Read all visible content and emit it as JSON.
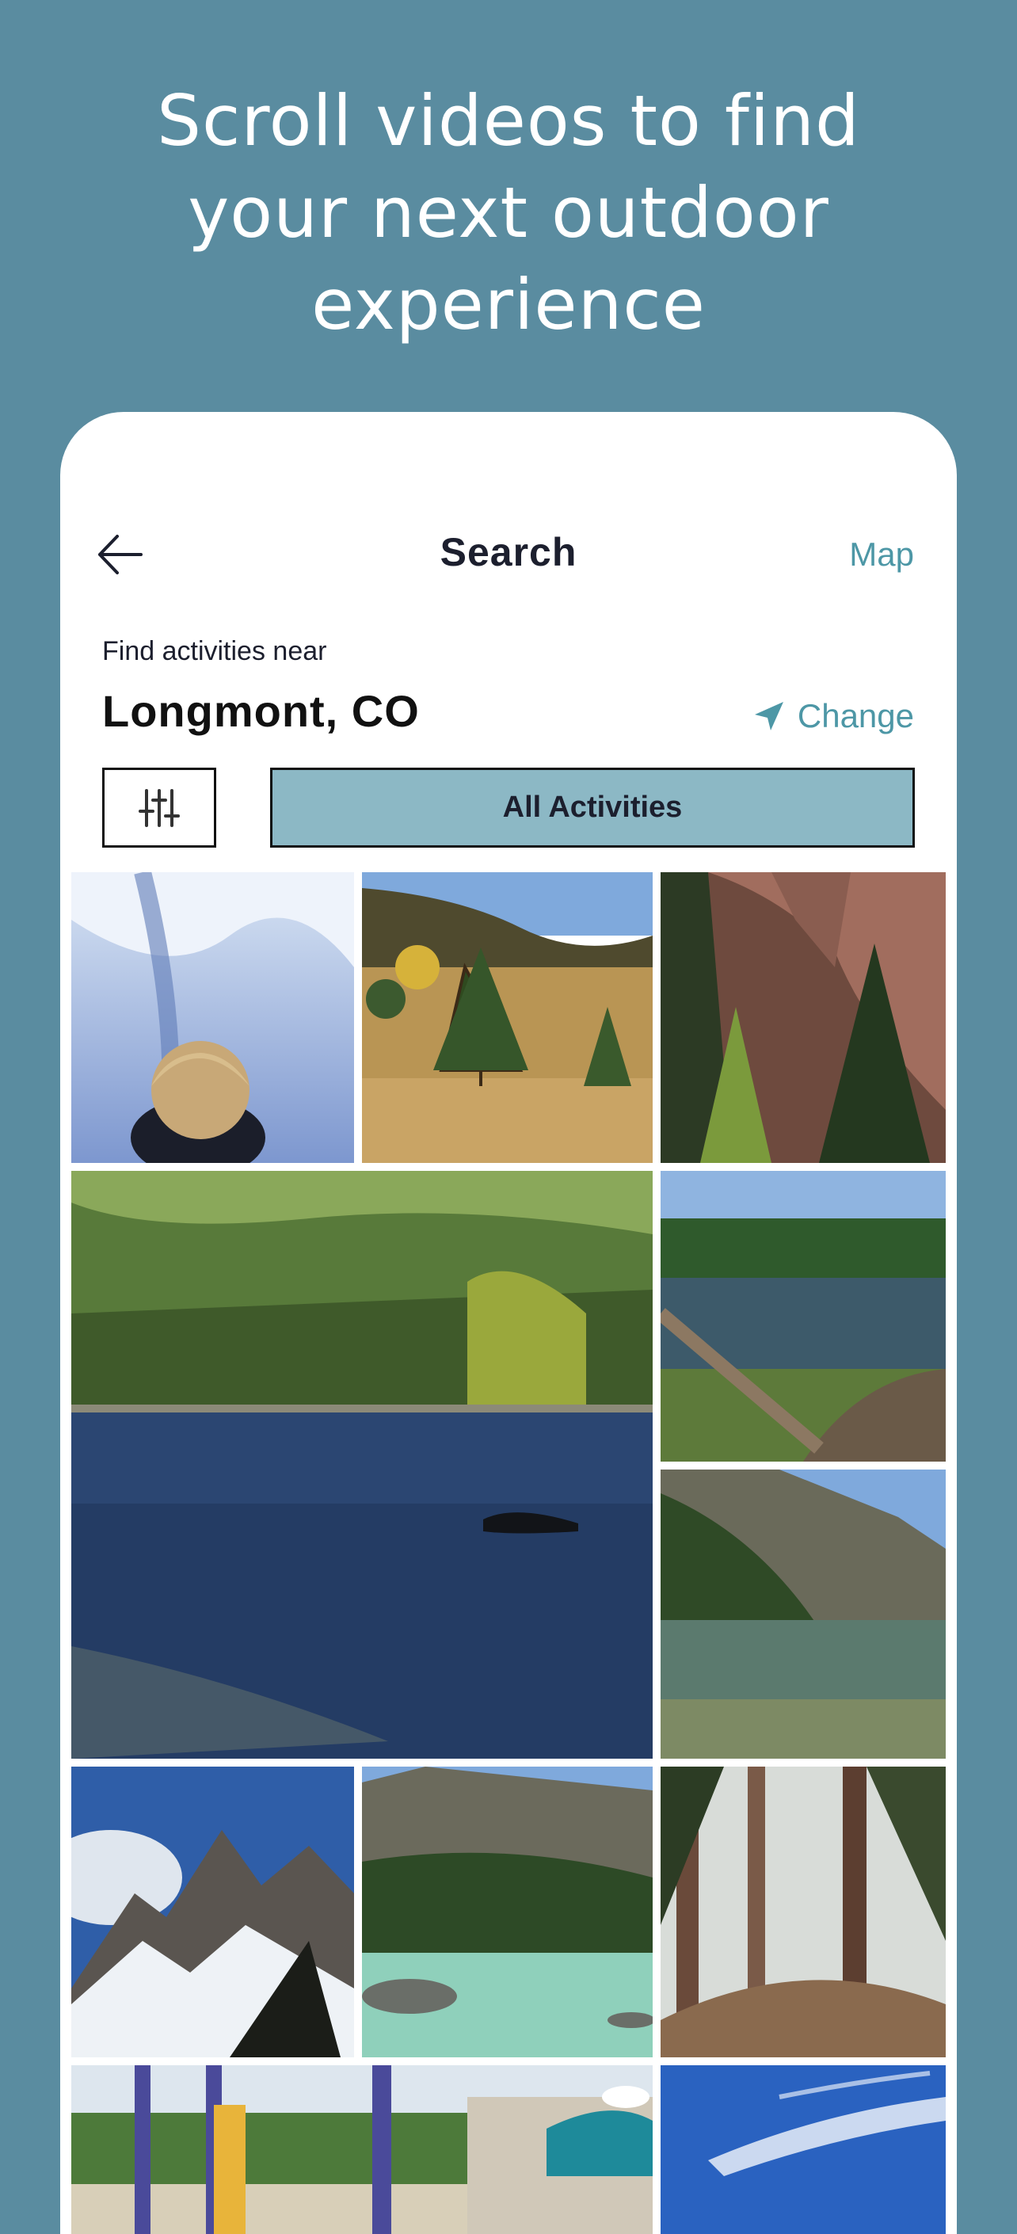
{
  "headline": {
    "line1": "Scroll videos to find",
    "line2": "your next outdoor",
    "line3": "experience"
  },
  "nav": {
    "back_icon": "arrow-left-icon",
    "title": "Search",
    "map_label": "Map"
  },
  "location": {
    "label": "Find activities near",
    "city": "Longmont, CO",
    "change_label": "Change",
    "change_icon": "location-arrow-icon"
  },
  "filters": {
    "filter_icon": "sliders-icon",
    "activities_label": "All Activities"
  },
  "videos": [
    {
      "scene": "child in snow"
    },
    {
      "scene": "autumn meadow with pine"
    },
    {
      "scene": "red rock cliffs with pines"
    },
    {
      "scene": "mountain lake with forest"
    },
    {
      "scene": "pond with fallen log"
    },
    {
      "scene": "alpine lake below peaks"
    },
    {
      "scene": "snowy mountain peaks"
    },
    {
      "scene": "turquoise lake"
    },
    {
      "scene": "forest trail"
    },
    {
      "scene": "playground"
    },
    {
      "scene": "blue sky with clouds"
    }
  ],
  "colors": {
    "background": "#5a8ca0",
    "accent": "#4d97a6",
    "activities_button": "#8cb8c5",
    "text_dark": "#1c1f2e"
  }
}
